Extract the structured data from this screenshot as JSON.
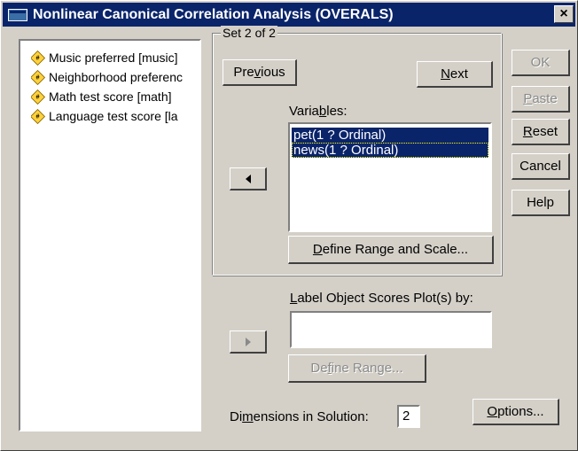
{
  "title": "Nonlinear Canonical Correlation Analysis (OVERALS)",
  "close_glyph": "×",
  "source_variables": [
    {
      "label": "Music preferred [music]"
    },
    {
      "label": "Neighborhood preferenc"
    },
    {
      "label": "Math test score [math]"
    },
    {
      "label": "Language test score [la"
    }
  ],
  "var_icon": "#",
  "set": {
    "legend": "Set 2 of 2",
    "previous_pre": "Pre",
    "previous_u": "v",
    "previous_post": "ious",
    "next_u": "N",
    "next_post": "ext",
    "variables_label_pre": "Varia",
    "variables_label_u": "b",
    "variables_label_post": "les:",
    "variables": [
      {
        "label": "pet(1 ? Ordinal)"
      },
      {
        "label": "news(1 ? Ordinal)"
      }
    ],
    "define_range_scale_u": "D",
    "define_range_scale_post": "efine Range and Scale..."
  },
  "label_object": {
    "label_u": "L",
    "label_post": "abel Object Scores Plot(s) by:",
    "value": "",
    "define_range_pre": "De",
    "define_range_u": "f",
    "define_range_post": "ine Range..."
  },
  "dimensions": {
    "label_pre": "Di",
    "label_u": "m",
    "label_post": "ensions in Solution:",
    "value": "2"
  },
  "buttons": {
    "ok": "OK",
    "paste_u": "P",
    "paste_post": "aste",
    "reset_u": "R",
    "reset_post": "eset",
    "cancel": "Cancel",
    "help": "Help",
    "options_u": "O",
    "options_post": "ptions..."
  }
}
